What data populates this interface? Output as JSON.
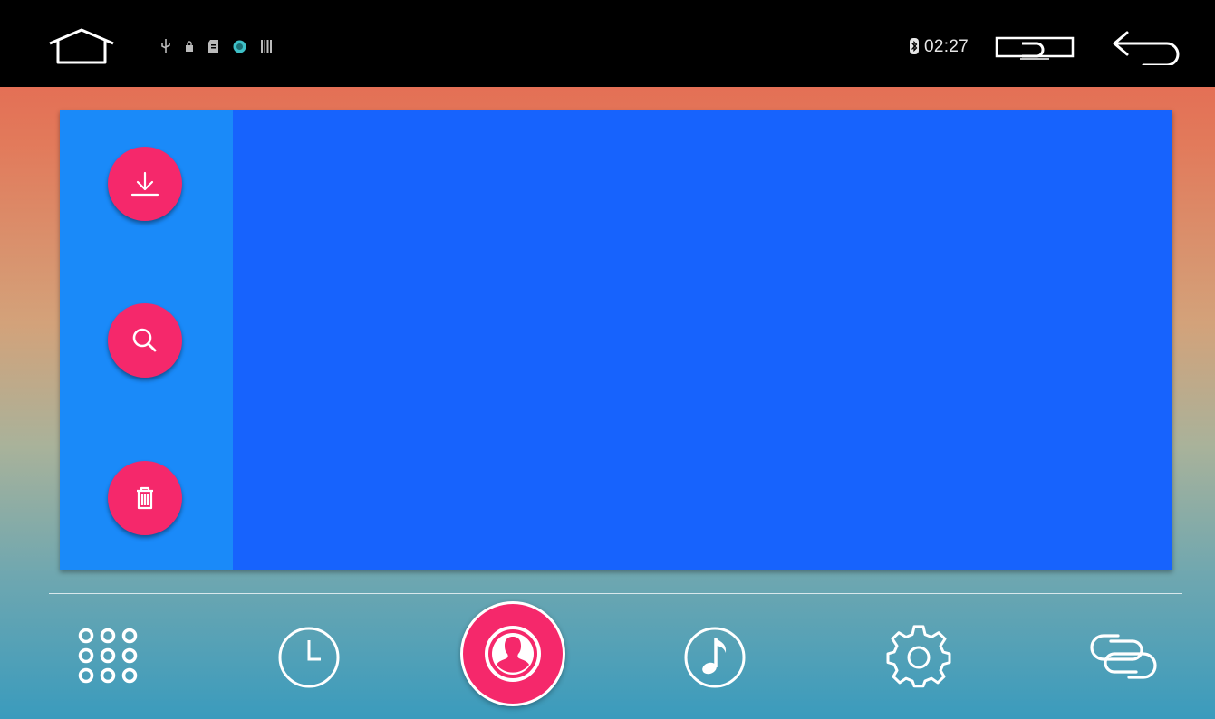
{
  "status_bar": {
    "clock": "02:27",
    "icons": [
      "home-icon",
      "usb-icon",
      "lock-icon",
      "sd-card-icon",
      "android-debug-icon",
      "barcode-icon",
      "bluetooth-icon",
      "display-mode-icon",
      "back-icon"
    ]
  },
  "panel": {
    "actions": [
      {
        "name": "download-button",
        "icon": "download-icon"
      },
      {
        "name": "search-button",
        "icon": "search-icon"
      },
      {
        "name": "delete-button",
        "icon": "trash-icon"
      }
    ]
  },
  "bottom_nav": {
    "items": [
      {
        "name": "nav-keypad",
        "icon": "dialpad-icon",
        "active": false
      },
      {
        "name": "nav-recent-calls",
        "icon": "clock-icon",
        "active": false
      },
      {
        "name": "nav-contacts",
        "icon": "contact-icon",
        "active": true
      },
      {
        "name": "nav-music",
        "icon": "music-note-icon",
        "active": false
      },
      {
        "name": "nav-settings",
        "icon": "gear-icon",
        "active": false
      },
      {
        "name": "nav-link",
        "icon": "link-icon",
        "active": false
      }
    ]
  },
  "colors": {
    "accent": "#f5286b",
    "panel": "#1763fd",
    "rail": "#1a8af9",
    "status_bar": "#000000"
  }
}
